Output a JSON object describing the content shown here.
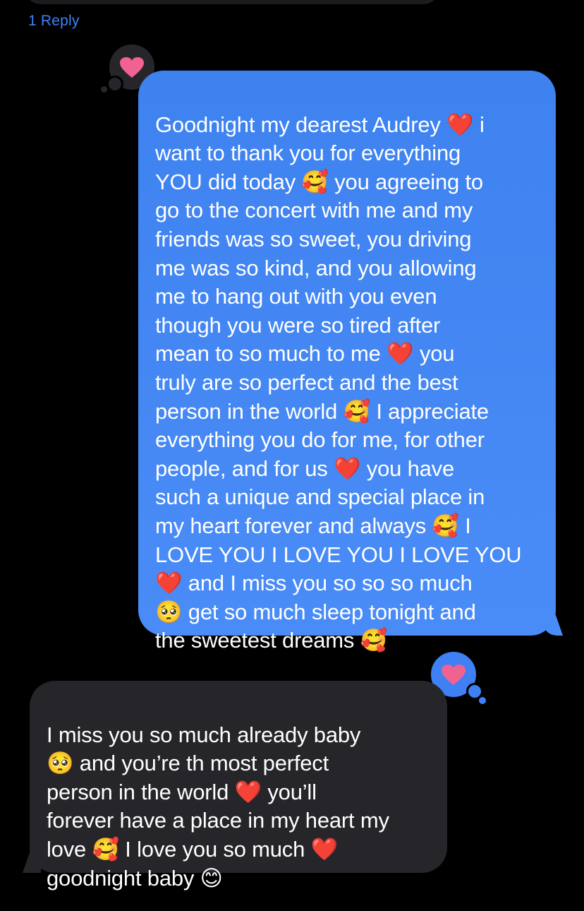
{
  "thread": {
    "reply_link": "1 Reply",
    "colors": {
      "background": "#000000",
      "sent_bubble": "#3e82f0",
      "received_bubble": "#26262a",
      "link": "#3b82f6",
      "heart_reaction": "#f06292"
    }
  },
  "tapbacks": [
    {
      "target": "sent_message",
      "icon": "heart-icon",
      "reaction": "love"
    },
    {
      "target": "received_message",
      "icon": "heart-icon",
      "reaction": "love"
    }
  ],
  "messages": {
    "sent": {
      "direction": "outgoing",
      "text": "Goodnight my dearest Audrey ❤️ i\nwant to thank you for everything\nYOU did today 🥰 you agreeing to\ngo to the concert with me and my\nfriends was so sweet, you driving\nme was so kind, and you allowing\nme to hang out with you even\nthough you were so tired after\nmean to so much to me ❤️ you\ntruly are so perfect and the best\nperson in the world 🥰 I appreciate\neverything you do for me, for other\npeople, and for us ❤️ you have\nsuch a unique and special place in\nmy heart forever and always 🥰 I\nLOVE YOU I LOVE YOU I LOVE YOU\n❤️ and I miss you so so so much\n🥺 get so much sleep tonight and\nthe sweetest dreams 🥰"
    },
    "received": {
      "direction": "incoming",
      "text": "I miss you so much already baby\n🥺 and you’re th most perfect\nperson in the world ❤️ you’ll\nforever have a place in my heart my\nlove 🥰 I love you so much ❤️\ngoodnight baby 😊"
    }
  }
}
